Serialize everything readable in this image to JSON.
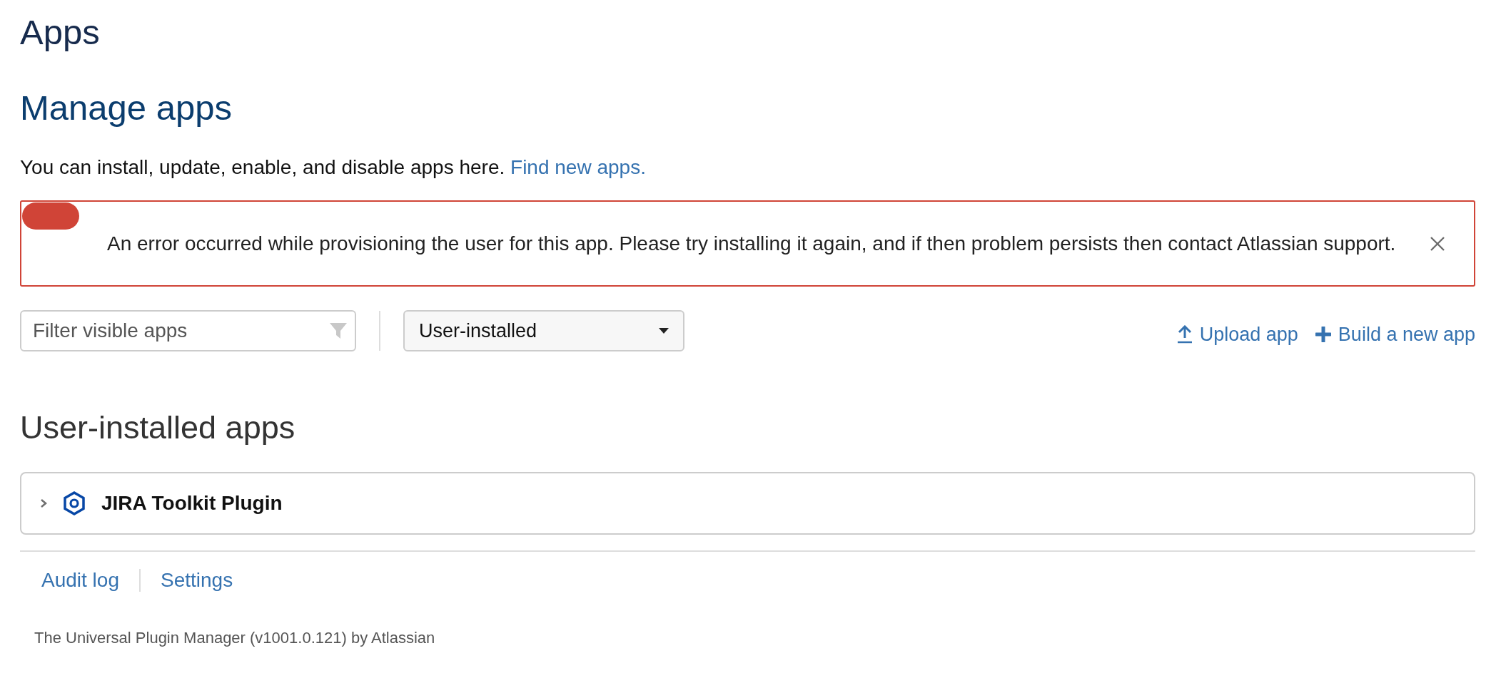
{
  "page_title": "Apps",
  "heading": "Manage apps",
  "description": {
    "text": "You can install, update, enable, and disable apps here.",
    "link": "Find new apps."
  },
  "error_message": {
    "text": "An error occurred while provisioning the user for this app. Please try installing it again, and if then problem persists then contact Atlassian support."
  },
  "filter": {
    "placeholder": "Filter visible apps"
  },
  "dropdown": {
    "value": "User-installed"
  },
  "actions": [
    {
      "kind": "upload",
      "label": "Upload app"
    },
    {
      "kind": "build",
      "label": "Build a new app"
    }
  ],
  "section_title": "User-installed apps",
  "apps": [
    {
      "name": "JIRA Toolkit Plugin",
      "expanded": false
    }
  ],
  "footer_links": [
    "Audit log",
    "Settings"
  ],
  "footer_text": "The Universal Plugin Manager (v1001.0.121) by Atlassian"
}
